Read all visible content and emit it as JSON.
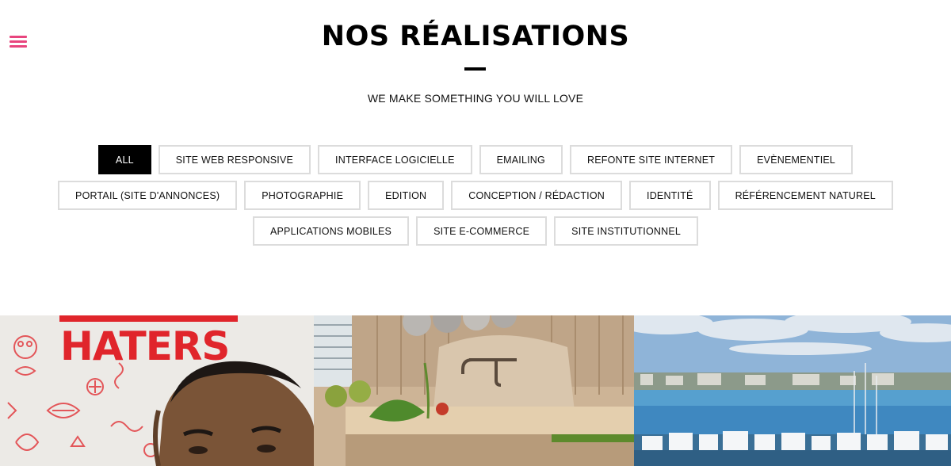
{
  "header": {
    "title": "NOS RÉALISATIONS",
    "subtitle": "WE MAKE SOMETHING YOU WILL LOVE",
    "menu_icon": "hamburger-icon",
    "menu_icon_color": "#e8457e"
  },
  "filters": [
    {
      "label": "ALL",
      "active": true
    },
    {
      "label": "SITE WEB RESPONSIVE",
      "active": false
    },
    {
      "label": "INTERFACE LOGICIELLE",
      "active": false
    },
    {
      "label": "EMAILING",
      "active": false
    },
    {
      "label": "REFONTE SITE INTERNET",
      "active": false
    },
    {
      "label": "EVÈNEMENTIEL",
      "active": false
    },
    {
      "label": "PORTAIL (SITE D'ANNONCES)",
      "active": false
    },
    {
      "label": "PHOTOGRAPHIE",
      "active": false
    },
    {
      "label": "EDITION",
      "active": false
    },
    {
      "label": "CONCEPTION / RÉDACTION",
      "active": false
    },
    {
      "label": "IDENTITÉ",
      "active": false
    },
    {
      "label": "RÉFÉRENCEMENT NATUREL",
      "active": false
    },
    {
      "label": "APPLICATIONS MOBILES",
      "active": false
    },
    {
      "label": "SITE E-COMMERCE",
      "active": false
    },
    {
      "label": "SITE INSTITUTIONNEL",
      "active": false
    }
  ],
  "gallery": {
    "items": [
      {
        "name": "portfolio-item-haters",
        "poster_text": "HATERS"
      },
      {
        "name": "portfolio-item-kitchen"
      },
      {
        "name": "portfolio-item-harbor"
      }
    ]
  },
  "colors": {
    "accent": "#e8457e",
    "active_filter_bg": "#000000",
    "filter_border": "#dcdcdc",
    "poster_red": "#e0252b"
  }
}
